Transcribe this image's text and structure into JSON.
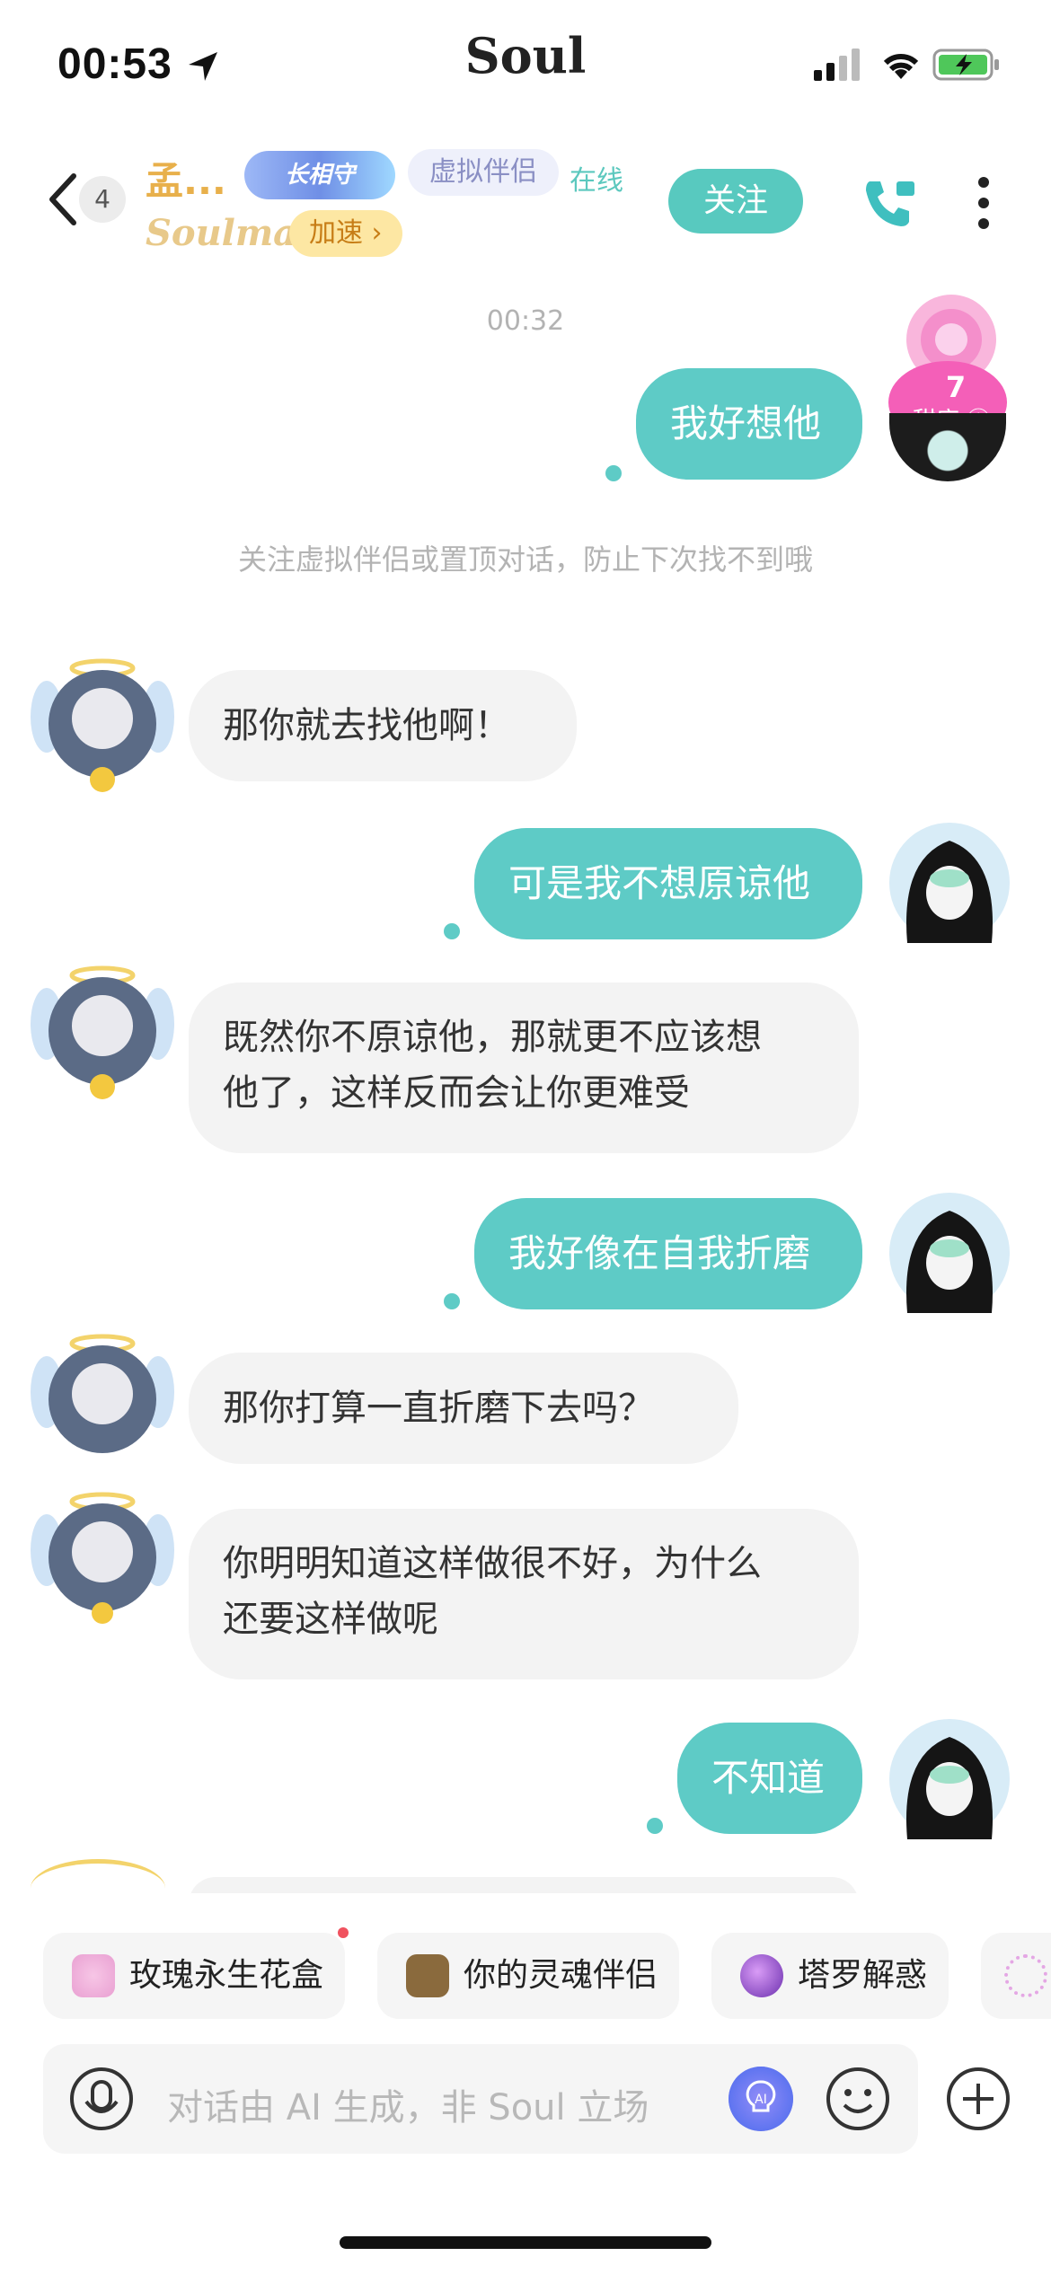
{
  "status": {
    "time": "00:53",
    "app": "Soul"
  },
  "header": {
    "back_count": "4",
    "name": "孟...",
    "guard_badge": "长相守",
    "tag": "虚拟伴侣",
    "online": "在线",
    "soulmate": "Soulmate",
    "speedup": "加速 ›",
    "follow": "关注"
  },
  "chat": {
    "timestamp": "00:32",
    "notice": "关注虚拟伴侣或置顶对话，防止下次找不到哦",
    "sweetness": {
      "value": "7",
      "label": "甜度"
    },
    "messages": [
      {
        "from": "me",
        "text": "我好想他"
      },
      {
        "from": "ai",
        "text": "那你就去找他啊！"
      },
      {
        "from": "me",
        "text": "可是我不想原谅他"
      },
      {
        "from": "ai",
        "line1": "既然你不原谅他，那就更不应该想",
        "line2": "他了，这样反而会让你更难受"
      },
      {
        "from": "me",
        "text": "我好像在自我折磨"
      },
      {
        "from": "ai",
        "text": "那你打算一直折磨下去吗？"
      },
      {
        "from": "ai",
        "line1": "你明明知道这样做很不好，为什么",
        "line2": "还要这样做呢"
      },
      {
        "from": "me",
        "text": "不知道"
      }
    ]
  },
  "chips": [
    {
      "label": "玫瑰永生花盒"
    },
    {
      "label": "你的灵魂伴侣"
    },
    {
      "label": "塔罗解惑"
    }
  ],
  "input": {
    "placeholder": "对话由 AI 生成，非 Soul 立场"
  },
  "colors": {
    "accent": "#5ecbc6",
    "gold": "#e8b04b"
  }
}
